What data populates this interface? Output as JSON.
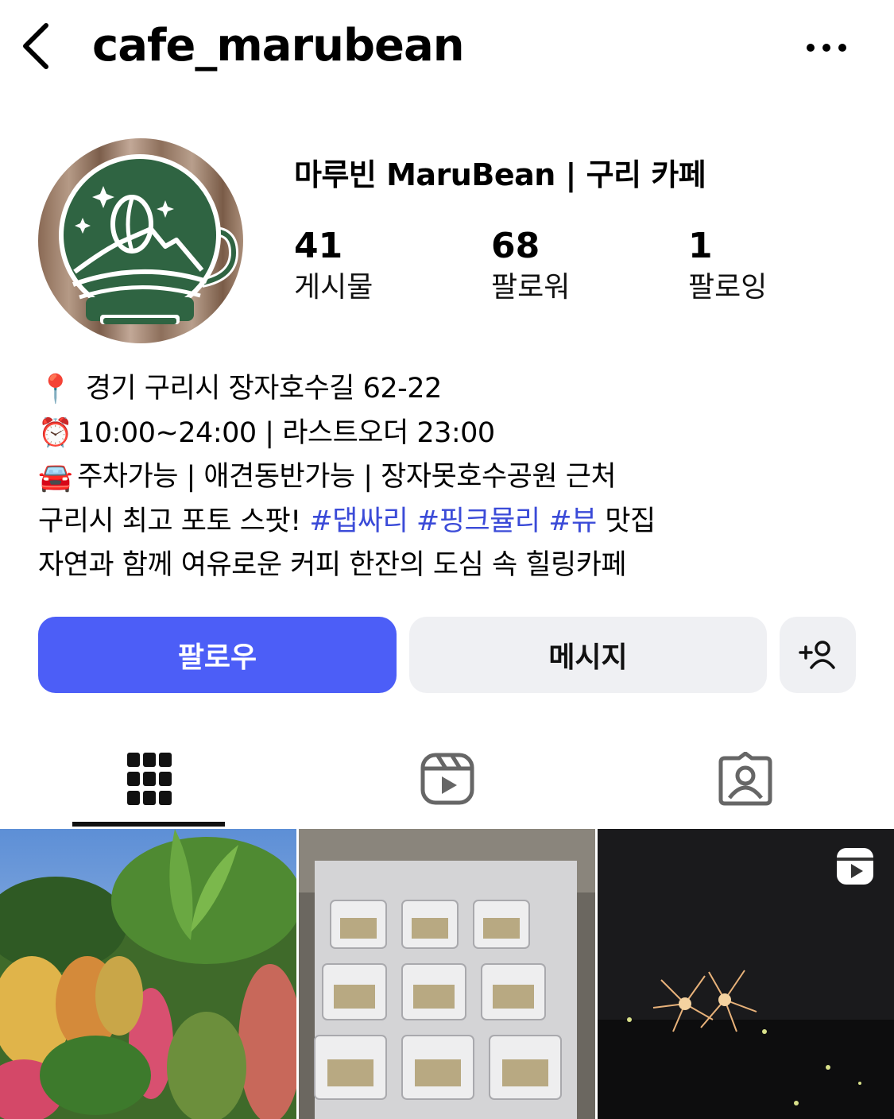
{
  "header": {
    "username": "cafe_marubean",
    "back_icon": "chevron-left-icon",
    "more_icon": "more-horizontal-icon"
  },
  "profile": {
    "display_name": "마루빈 MaruBean | 구리 카페",
    "stats": {
      "posts": {
        "count": "41",
        "label": "게시물"
      },
      "followers": {
        "count": "68",
        "label": "팔로워"
      },
      "following": {
        "count": "1",
        "label": "팔로잉"
      }
    }
  },
  "bio": {
    "address_emoji": "📍",
    "address": " 경기 구리시 장자호수길 62-22",
    "hours_emoji": "⏰",
    "hours": "10:00~24:00 | 라스트오더 23:00",
    "amenities_emoji": "🚘",
    "amenities": "주차가능 | 애견동반가능 | 장자못호수공원 근처",
    "photo_spot_prefix": "구리시 최고 포토 스팟! ",
    "hashtags": [
      "#댑싸리",
      "#핑크뮬리",
      "#뷰"
    ],
    "photo_spot_suffix": " 맛집",
    "tagline": "자연과 함께 여유로운 커피 한잔의 도심 속 힐링카페"
  },
  "actions": {
    "follow_label": "팔로우",
    "message_label": "메시지",
    "add_user_icon": "add-person-icon"
  },
  "tabs": [
    {
      "name": "posts",
      "icon": "grid-icon",
      "active": true
    },
    {
      "name": "reels",
      "icon": "reels-icon",
      "active": false
    },
    {
      "name": "tagged",
      "icon": "tagged-person-icon",
      "active": false
    }
  ],
  "colors": {
    "follow_button": "#4c5ef7",
    "secondary_button": "#eff0f3",
    "hashtag": "#3b4bd8",
    "logo_green": "#2f6442"
  },
  "posts": [
    {
      "type": "image",
      "subject": "garden-photo"
    },
    {
      "type": "image",
      "subject": "packaged-items-photo"
    },
    {
      "type": "reel",
      "subject": "fireworks-night-photo"
    }
  ]
}
